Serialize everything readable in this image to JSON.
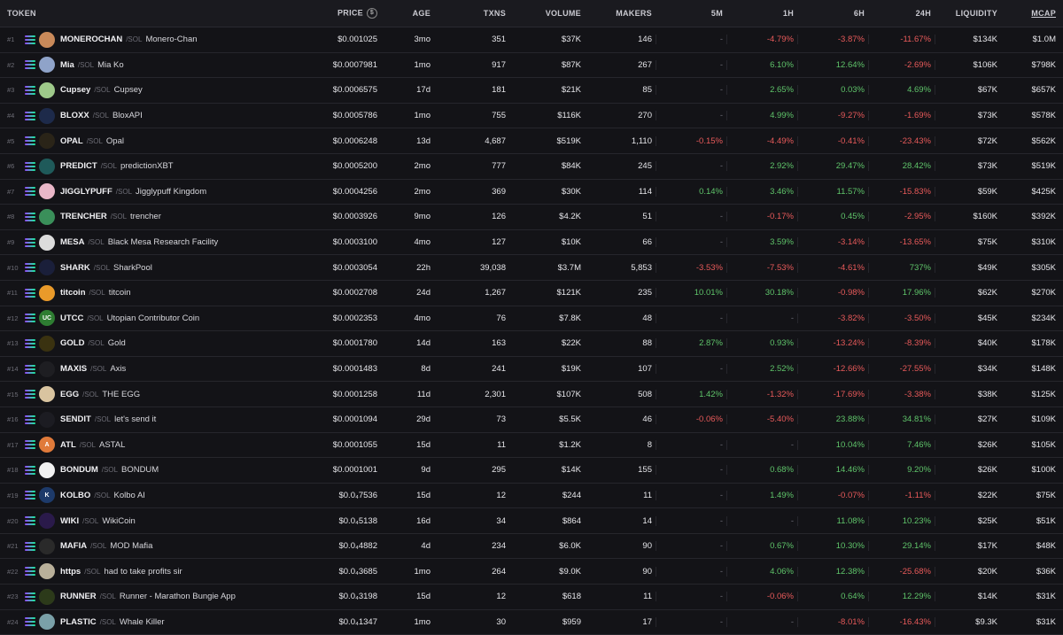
{
  "headers": {
    "token": "TOKEN",
    "price": "PRICE",
    "price_icon": "$",
    "age": "AGE",
    "txns": "TXNS",
    "volume": "VOLUME",
    "makers": "MAKERS",
    "m5": "5M",
    "h1": "1H",
    "h6": "6H",
    "h24": "24H",
    "liquidity": "LIQUIDITY",
    "mcap": "MCAP"
  },
  "chain_label": "/SOL",
  "rows": [
    {
      "rank": "#1",
      "symbol": "MONEROCHAN",
      "name": "Monero-Chan",
      "price": "$0.001025",
      "age": "3mo",
      "txns": "351",
      "volume": "$37K",
      "makers": "146",
      "m5": "-",
      "h1": "-4.79%",
      "h6": "-3.87%",
      "h24": "-11.67%",
      "liquidity": "$134K",
      "mcap": "$1.0M",
      "avatar_color": "#c98a5a",
      "avatar_text": ""
    },
    {
      "rank": "#2",
      "symbol": "Mia",
      "name": "Mia Ko",
      "price": "$0.0007981",
      "age": "1mo",
      "txns": "917",
      "volume": "$87K",
      "makers": "267",
      "m5": "-",
      "h1": "6.10%",
      "h6": "12.64%",
      "h24": "-2.69%",
      "liquidity": "$106K",
      "mcap": "$798K",
      "avatar_color": "#8fa3c9",
      "avatar_text": ""
    },
    {
      "rank": "#3",
      "symbol": "Cupsey",
      "name": "Cupsey",
      "price": "$0.0006575",
      "age": "17d",
      "txns": "181",
      "volume": "$21K",
      "makers": "85",
      "m5": "-",
      "h1": "2.65%",
      "h6": "0.03%",
      "h24": "4.69%",
      "liquidity": "$67K",
      "mcap": "$657K",
      "avatar_color": "#9ec98a",
      "avatar_text": ""
    },
    {
      "rank": "#4",
      "symbol": "BLOXX",
      "name": "BloxAPI",
      "price": "$0.0005786",
      "age": "1mo",
      "txns": "755",
      "volume": "$116K",
      "makers": "270",
      "m5": "-",
      "h1": "4.99%",
      "h6": "-9.27%",
      "h24": "-1.69%",
      "liquidity": "$73K",
      "mcap": "$578K",
      "avatar_color": "#1d2a4a",
      "avatar_text": ""
    },
    {
      "rank": "#5",
      "symbol": "OPAL",
      "name": "Opal",
      "price": "$0.0006248",
      "age": "13d",
      "txns": "4,687",
      "volume": "$519K",
      "makers": "1,110",
      "m5": "-0.15%",
      "h1": "-4.49%",
      "h6": "-0.41%",
      "h24": "-23.43%",
      "liquidity": "$72K",
      "mcap": "$562K",
      "avatar_color": "#2a2418",
      "avatar_text": ""
    },
    {
      "rank": "#6",
      "symbol": "PREDICT",
      "name": "predictionXBT",
      "price": "$0.0005200",
      "age": "2mo",
      "txns": "777",
      "volume": "$84K",
      "makers": "245",
      "m5": "-",
      "h1": "2.92%",
      "h6": "29.47%",
      "h24": "28.42%",
      "liquidity": "$73K",
      "mcap": "$519K",
      "avatar_color": "#1f5a5a",
      "avatar_text": ""
    },
    {
      "rank": "#7",
      "symbol": "JIGGLYPUFF",
      "name": "Jigglypuff Kingdom",
      "price": "$0.0004256",
      "age": "2mo",
      "txns": "369",
      "volume": "$30K",
      "makers": "114",
      "m5": "0.14%",
      "h1": "3.46%",
      "h6": "11.57%",
      "h24": "-15.83%",
      "liquidity": "$59K",
      "mcap": "$425K",
      "avatar_color": "#e9b7c8",
      "avatar_text": ""
    },
    {
      "rank": "#8",
      "symbol": "TRENCHER",
      "name": "trencher",
      "price": "$0.0003926",
      "age": "9mo",
      "txns": "126",
      "volume": "$4.2K",
      "makers": "51",
      "m5": "-",
      "h1": "-0.17%",
      "h6": "0.45%",
      "h24": "-2.95%",
      "liquidity": "$160K",
      "mcap": "$392K",
      "avatar_color": "#3a8f5a",
      "avatar_text": ""
    },
    {
      "rank": "#9",
      "symbol": "MESA",
      "name": "Black Mesa Research Facility",
      "price": "$0.0003100",
      "age": "4mo",
      "txns": "127",
      "volume": "$10K",
      "makers": "66",
      "m5": "-",
      "h1": "3.59%",
      "h6": "-3.14%",
      "h24": "-13.65%",
      "liquidity": "$75K",
      "mcap": "$310K",
      "avatar_color": "#dcdcdc",
      "avatar_text": ""
    },
    {
      "rank": "#10",
      "symbol": "SHARK",
      "name": "SharkPool",
      "price": "$0.0003054",
      "age": "22h",
      "txns": "39,038",
      "volume": "$3.7M",
      "makers": "5,853",
      "m5": "-3.53%",
      "h1": "-7.53%",
      "h6": "-4.61%",
      "h24": "737%",
      "liquidity": "$49K",
      "mcap": "$305K",
      "avatar_color": "#1a1f3a",
      "avatar_text": ""
    },
    {
      "rank": "#11",
      "symbol": "titcoin",
      "name": "titcoin",
      "price": "$0.0002708",
      "age": "24d",
      "txns": "1,267",
      "volume": "$121K",
      "makers": "235",
      "m5": "10.01%",
      "h1": "30.18%",
      "h6": "-0.98%",
      "h24": "17.96%",
      "liquidity": "$62K",
      "mcap": "$270K",
      "avatar_color": "#e99a2a",
      "avatar_text": ""
    },
    {
      "rank": "#12",
      "symbol": "UTCC",
      "name": "Utopian Contributor Coin",
      "price": "$0.0002353",
      "age": "4mo",
      "txns": "76",
      "volume": "$7.8K",
      "makers": "48",
      "m5": "-",
      "h1": "-",
      "h6": "-3.82%",
      "h24": "-3.50%",
      "liquidity": "$45K",
      "mcap": "$234K",
      "avatar_color": "#2e7d32",
      "avatar_text": "UC"
    },
    {
      "rank": "#13",
      "symbol": "GOLD",
      "name": "Gold",
      "price": "$0.0001780",
      "age": "14d",
      "txns": "163",
      "volume": "$22K",
      "makers": "88",
      "m5": "2.87%",
      "h1": "0.93%",
      "h6": "-13.24%",
      "h24": "-8.39%",
      "liquidity": "$40K",
      "mcap": "$178K",
      "avatar_color": "#3a3210",
      "avatar_text": ""
    },
    {
      "rank": "#14",
      "symbol": "MAXIS",
      "name": "Axis",
      "price": "$0.0001483",
      "age": "8d",
      "txns": "241",
      "volume": "$19K",
      "makers": "107",
      "m5": "-",
      "h1": "2.52%",
      "h6": "-12.66%",
      "h24": "-27.55%",
      "liquidity": "$34K",
      "mcap": "$148K",
      "avatar_color": "#1e1e22",
      "avatar_text": ""
    },
    {
      "rank": "#15",
      "symbol": "EGG",
      "name": "THE EGG",
      "price": "$0.0001258",
      "age": "11d",
      "txns": "2,301",
      "volume": "$107K",
      "makers": "508",
      "m5": "1.42%",
      "h1": "-1.32%",
      "h6": "-17.69%",
      "h24": "-3.38%",
      "liquidity": "$38K",
      "mcap": "$125K",
      "avatar_color": "#d9c4a0",
      "avatar_text": ""
    },
    {
      "rank": "#16",
      "symbol": "SENDIT",
      "name": "let's send it",
      "price": "$0.0001094",
      "age": "29d",
      "txns": "73",
      "volume": "$5.5K",
      "makers": "46",
      "m5": "-0.06%",
      "h1": "-5.40%",
      "h6": "23.88%",
      "h24": "34.81%",
      "liquidity": "$27K",
      "mcap": "$109K",
      "avatar_color": "#1c1c22",
      "avatar_text": ""
    },
    {
      "rank": "#17",
      "symbol": "ATL",
      "name": "ASTAL",
      "price": "$0.0001055",
      "age": "15d",
      "txns": "11",
      "volume": "$1.2K",
      "makers": "8",
      "m5": "-",
      "h1": "-",
      "h6": "10.04%",
      "h24": "7.46%",
      "liquidity": "$26K",
      "mcap": "$105K",
      "avatar_color": "#e07a3a",
      "avatar_text": "A"
    },
    {
      "rank": "#18",
      "symbol": "BONDUM",
      "name": "BONDUM",
      "price": "$0.0001001",
      "age": "9d",
      "txns": "295",
      "volume": "$14K",
      "makers": "155",
      "m5": "-",
      "h1": "0.68%",
      "h6": "14.46%",
      "h24": "9.20%",
      "liquidity": "$26K",
      "mcap": "$100K",
      "avatar_color": "#f2f2f2",
      "avatar_text": ""
    },
    {
      "rank": "#19",
      "symbol": "KOLBO",
      "name": "Kolbo AI",
      "price": "$0.0₄7536",
      "age": "15d",
      "txns": "12",
      "volume": "$244",
      "makers": "11",
      "m5": "-",
      "h1": "1.49%",
      "h6": "-0.07%",
      "h24": "-1.11%",
      "liquidity": "$22K",
      "mcap": "$75K",
      "avatar_color": "#1d3a6a",
      "avatar_text": "K"
    },
    {
      "rank": "#20",
      "symbol": "WIKI",
      "name": "WikiCoin",
      "price": "$0.0₄5138",
      "age": "16d",
      "txns": "34",
      "volume": "$864",
      "makers": "14",
      "m5": "-",
      "h1": "-",
      "h6": "11.08%",
      "h24": "10.23%",
      "liquidity": "$25K",
      "mcap": "$51K",
      "avatar_color": "#2a1a4a",
      "avatar_text": ""
    },
    {
      "rank": "#21",
      "symbol": "MAFIA",
      "name": "MOD Mafia",
      "price": "$0.0₄4882",
      "age": "4d",
      "txns": "234",
      "volume": "$6.0K",
      "makers": "90",
      "m5": "-",
      "h1": "0.67%",
      "h6": "10.30%",
      "h24": "29.14%",
      "liquidity": "$17K",
      "mcap": "$48K",
      "avatar_color": "#2a2a2a",
      "avatar_text": ""
    },
    {
      "rank": "#22",
      "symbol": "https",
      "name": "had to take profits sir",
      "price": "$0.0₄3685",
      "age": "1mo",
      "txns": "264",
      "volume": "$9.0K",
      "makers": "90",
      "m5": "-",
      "h1": "4.06%",
      "h6": "12.38%",
      "h24": "-25.68%",
      "liquidity": "$20K",
      "mcap": "$36K",
      "avatar_color": "#b9b09a",
      "avatar_text": ""
    },
    {
      "rank": "#23",
      "symbol": "RUNNER",
      "name": "Runner - Marathon Bungie App",
      "price": "$0.0₄3198",
      "age": "15d",
      "txns": "12",
      "volume": "$618",
      "makers": "11",
      "m5": "-",
      "h1": "-0.06%",
      "h6": "0.64%",
      "h24": "12.29%",
      "liquidity": "$14K",
      "mcap": "$31K",
      "avatar_color": "#2c3a1a",
      "avatar_text": ""
    },
    {
      "rank": "#24",
      "symbol": "PLASTIC",
      "name": "Whale Killer",
      "price": "$0.0₄1347",
      "age": "1mo",
      "txns": "30",
      "volume": "$959",
      "makers": "17",
      "m5": "-",
      "h1": "-",
      "h6": "-8.01%",
      "h24": "-16.43%",
      "liquidity": "$9.3K",
      "mcap": "$31K",
      "avatar_color": "#7aa0a8",
      "avatar_text": ""
    }
  ],
  "colors": {
    "positive": "#5fc46a",
    "negative": "#e85a5a",
    "neutral": "#6d6d76",
    "background": "#131317"
  }
}
